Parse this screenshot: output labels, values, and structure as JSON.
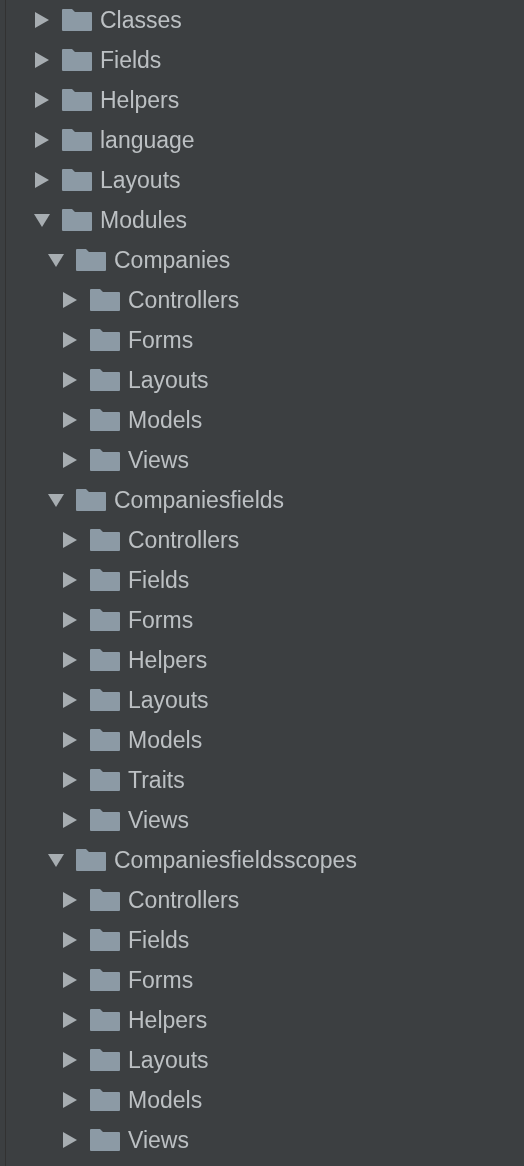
{
  "tree": [
    {
      "label": "Classes",
      "expanded": false
    },
    {
      "label": "Fields",
      "expanded": false
    },
    {
      "label": "Helpers",
      "expanded": false
    },
    {
      "label": "language",
      "expanded": false
    },
    {
      "label": "Layouts",
      "expanded": false
    },
    {
      "label": "Modules",
      "expanded": true,
      "children": [
        {
          "label": "Companies",
          "expanded": true,
          "children": [
            {
              "label": "Controllers",
              "expanded": false
            },
            {
              "label": "Forms",
              "expanded": false
            },
            {
              "label": "Layouts",
              "expanded": false
            },
            {
              "label": "Models",
              "expanded": false
            },
            {
              "label": "Views",
              "expanded": false
            }
          ]
        },
        {
          "label": "Companiesfields",
          "expanded": true,
          "children": [
            {
              "label": "Controllers",
              "expanded": false
            },
            {
              "label": "Fields",
              "expanded": false
            },
            {
              "label": "Forms",
              "expanded": false
            },
            {
              "label": "Helpers",
              "expanded": false
            },
            {
              "label": "Layouts",
              "expanded": false
            },
            {
              "label": "Models",
              "expanded": false
            },
            {
              "label": "Traits",
              "expanded": false
            },
            {
              "label": "Views",
              "expanded": false
            }
          ]
        },
        {
          "label": "Companiesfieldsscopes",
          "expanded": true,
          "children": [
            {
              "label": "Controllers",
              "expanded": false
            },
            {
              "label": "Fields",
              "expanded": false
            },
            {
              "label": "Forms",
              "expanded": false
            },
            {
              "label": "Helpers",
              "expanded": false
            },
            {
              "label": "Layouts",
              "expanded": false
            },
            {
              "label": "Models",
              "expanded": false
            },
            {
              "label": "Views",
              "expanded": false
            }
          ]
        }
      ]
    }
  ]
}
